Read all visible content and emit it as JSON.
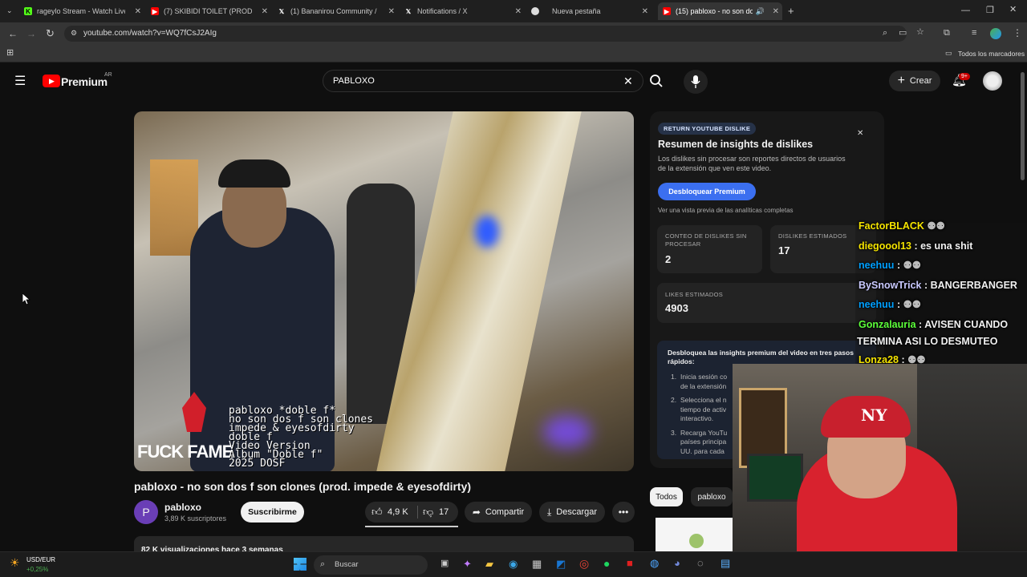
{
  "browser": {
    "tabs": [
      {
        "label": "rageylo Stream - Watch Live on",
        "icon": "kick-icon",
        "color": "#53fc18"
      },
      {
        "label": "(7) SKIBIDI TOILET (PROD.CERO",
        "icon": "youtube-icon",
        "color": "#ff0000"
      },
      {
        "label": "(1) Bananirou Community / X",
        "icon": "x-icon",
        "color": "#ffffff"
      },
      {
        "label": "Notifications / X",
        "icon": "x-icon",
        "color": "#ffffff"
      },
      {
        "label": "Nueva pestaña",
        "icon": "chrome-icon",
        "color": "#ffffff"
      },
      {
        "label": "(15) pabloxo - no son dos f",
        "icon": "youtube-icon",
        "color": "#ff0000"
      }
    ],
    "url": "youtube.com/watch?v=WQ7fCsJ2AIg",
    "bookmarks_label": "Todos los marcadores"
  },
  "youtube": {
    "logo_text": "Premium",
    "region": "AR",
    "search_value": "PABLOXO",
    "create_label": "Crear",
    "notif_count": "9+",
    "video": {
      "overlay_lines": [
        "pabloxo *doble f*",
        "no son dos f son clones",
        "impede & eyesofdirty",
        "doble f",
        "Video Version",
        "Album \"Doble f\"",
        "2025 DOSF"
      ],
      "brand": "FUCK FAME"
    },
    "title": "pabloxo - no son dos f son clones (prod. impede & eyesofdirty)",
    "channel": {
      "name": "pabloxo",
      "subs": "3,89 K suscriptores",
      "avatar_letter": "P",
      "subscribe": "Suscribirme"
    },
    "actions": {
      "likes": "4,9 K",
      "dislikes": "17",
      "share": "Compartir",
      "download": "Descargar"
    },
    "views": "82 K visualizaciones hace 3 semanas",
    "chips": [
      "Todos",
      "pabloxo"
    ]
  },
  "dislike_panel": {
    "badge": "RETURN YOUTUBE DISLIKE",
    "title": "Resumen de insights de dislikes",
    "desc": "Los dislikes sin procesar son reportes directos de usuarios de la extensión que ven este video.",
    "unlock": "Desbloquear Premium",
    "preview": "Ver una vista previa de las analíticas completas",
    "raw_label": "CONTEO DE DISLIKES SIN PROCESAR",
    "raw_value": "2",
    "est_label": "DISLIKES ESTIMADOS",
    "est_value": "17",
    "likes_label": "LIKES ESTIMADOS",
    "likes_value": "4903",
    "steps_title": "Desbloquea las insights premium del video en tres pasos rápidos:",
    "steps": [
      "Inicia sesión co de la extensión",
      "Selecciona el n tiempo de activ interactivo.",
      "Recarga YouTu países principa UU. para cada"
    ]
  },
  "chat": [
    {
      "user": "FactorBLACK",
      "msg": "",
      "color": "#f5e400"
    },
    {
      "user": "diegoool13",
      "msg": ": es una shit",
      "color": "#f5e400"
    },
    {
      "user": "neehuu",
      "msg": ":",
      "color": "#00a0ff"
    },
    {
      "user": "BySnowTrick",
      "msg": ": BANGERBANGER",
      "color": "#c9c9ff"
    },
    {
      "user": "neehuu",
      "msg": ":",
      "color": "#00a0ff"
    },
    {
      "user": "Gonzalauria",
      "msg": ": AVISEN CUANDO",
      "color": "#5cff3a"
    },
    {
      "user": "",
      "msg": "TERMINA ASI LO DESMUTEO",
      "color": "#ffffff"
    },
    {
      "user": "Lonza28",
      "msg": ":",
      "color": "#f5e400"
    }
  ],
  "taskbar": {
    "currency": "USD/EUR",
    "change": "+0,25%",
    "search_label": "Buscar"
  }
}
